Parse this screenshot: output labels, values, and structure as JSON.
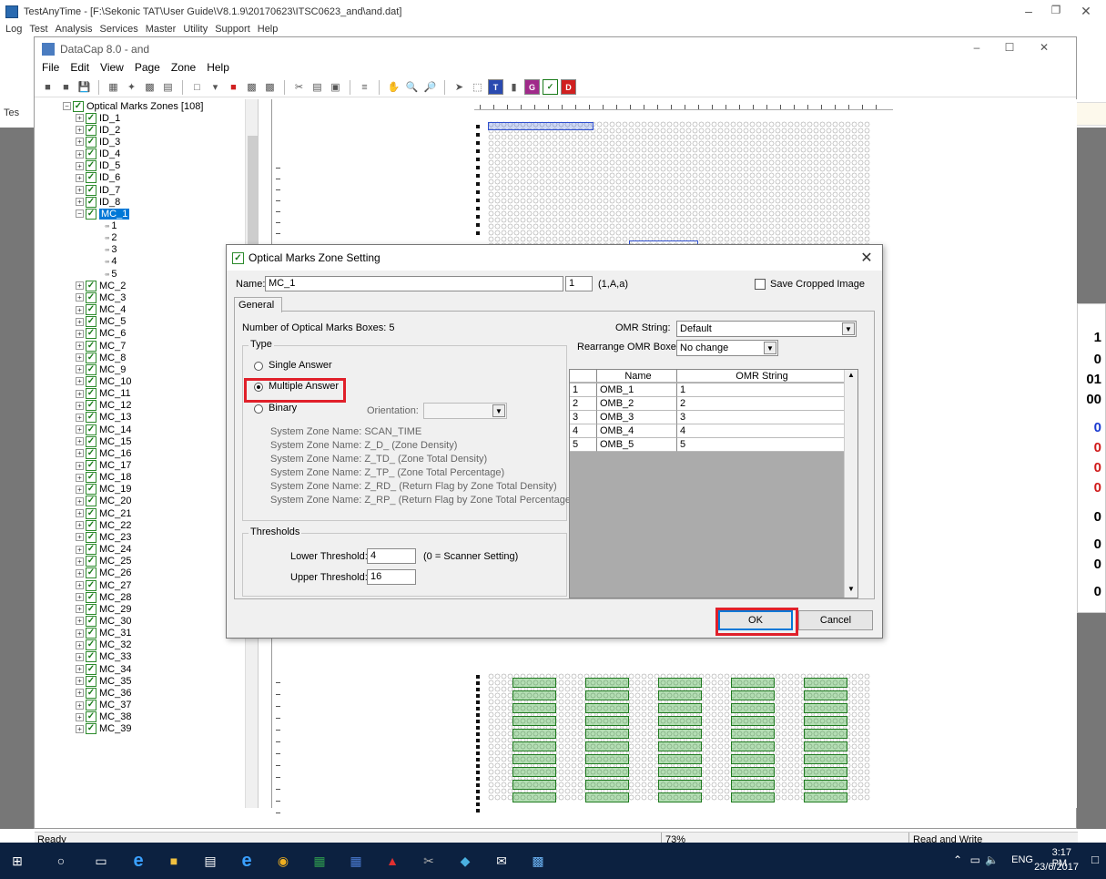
{
  "outer": {
    "title": "TestAnyTime - [F:\\Sekonic TAT\\User Guide\\V8.1.9\\20170623\\ITSC0623_and\\and.dat]",
    "menu": [
      "Log",
      "Test",
      "Analysis",
      "Services",
      "Master",
      "Utility",
      "Support",
      "Help"
    ],
    "left_label": "Tes",
    "right_values": [
      "1",
      "0",
      "01",
      "00",
      "0",
      "0",
      "0",
      "0",
      "0",
      "0",
      "0",
      "0"
    ]
  },
  "datacap": {
    "title": "DataCap 8.0 - and",
    "menu": [
      "File",
      "Edit",
      "View",
      "Page",
      "Zone",
      "Help"
    ],
    "tree": {
      "root": "Optical Marks Zones [108]",
      "selected": "MC_1",
      "children_of_selected": [
        "1",
        "2",
        "3",
        "4",
        "5"
      ],
      "items_before": [
        "ID_1",
        "ID_2",
        "ID_3",
        "ID_4",
        "ID_5",
        "ID_6",
        "ID_7",
        "ID_8",
        "MC_1"
      ],
      "items_after": [
        "MC_2",
        "MC_3",
        "MC_4",
        "MC_5",
        "MC_6",
        "MC_7",
        "MC_8",
        "MC_9",
        "MC_10",
        "MC_11",
        "MC_12",
        "MC_13",
        "MC_14",
        "MC_15",
        "MC_16",
        "MC_17",
        "MC_18",
        "MC_19",
        "MC_20",
        "MC_21",
        "MC_22",
        "MC_23",
        "MC_24",
        "MC_25",
        "MC_26",
        "MC_27",
        "MC_28",
        "MC_29",
        "MC_30",
        "MC_31",
        "MC_32",
        "MC_33",
        "MC_34",
        "MC_35",
        "MC_36",
        "MC_37",
        "MC_38",
        "MC_39"
      ]
    },
    "status": {
      "left": "Ready",
      "zoom": "73%",
      "mode": "Read and Write"
    }
  },
  "dialog": {
    "title": "Optical Marks Zone Setting",
    "name_label": "Name:",
    "name_value": "MC_1",
    "index_value": "1",
    "format_hint": "(1,A,a)",
    "save_cropped_label": "Save Cropped Image",
    "tab_general": "General",
    "num_boxes_text": "Number of Optical Marks Boxes: 5",
    "type_group": "Type",
    "single_answer": "Single Answer",
    "multiple_answer": "Multiple Answer",
    "binary": "Binary",
    "orientation_label": "Orientation:",
    "system_zones": [
      "System Zone Name: SCAN_TIME",
      "System Zone Name: Z_D_ (Zone Density)",
      "System Zone Name: Z_TD_ (Zone Total Density)",
      "System Zone Name: Z_TP_ (Zone Total Percentage)",
      "System Zone Name: Z_RD_ (Return Flag by Zone Total Density)",
      "System Zone Name: Z_RP_ (Return Flag by Zone Total Percentage)"
    ],
    "thresholds_group": "Thresholds",
    "lower_label": "Lower Threshold:",
    "lower_value": "4",
    "lower_hint": "(0 = Scanner Setting)",
    "upper_label": "Upper Threshold:",
    "upper_value": "16",
    "omr_string_label": "OMR String:",
    "omr_string_value": "Default",
    "rearrange_label": "Rearrange OMR Boxes:",
    "rearrange_value": "No change",
    "table_headers": [
      "Name",
      "OMR String"
    ],
    "table_rows": [
      {
        "n": "1",
        "name": "OMB_1",
        "str": "1"
      },
      {
        "n": "2",
        "name": "OMB_2",
        "str": "2"
      },
      {
        "n": "3",
        "name": "OMB_3",
        "str": "3"
      },
      {
        "n": "4",
        "name": "OMB_4",
        "str": "4"
      },
      {
        "n": "5",
        "name": "OMB_5",
        "str": "5"
      }
    ],
    "ok_label": "OK",
    "cancel_label": "Cancel"
  },
  "taskbar": {
    "lang": "ENG",
    "time": "3:17 PM",
    "date": "23/6/2017"
  },
  "colors": {
    "highlight": "#e0202a",
    "selection": "#0078d7",
    "taskbar": "#0c2140"
  }
}
